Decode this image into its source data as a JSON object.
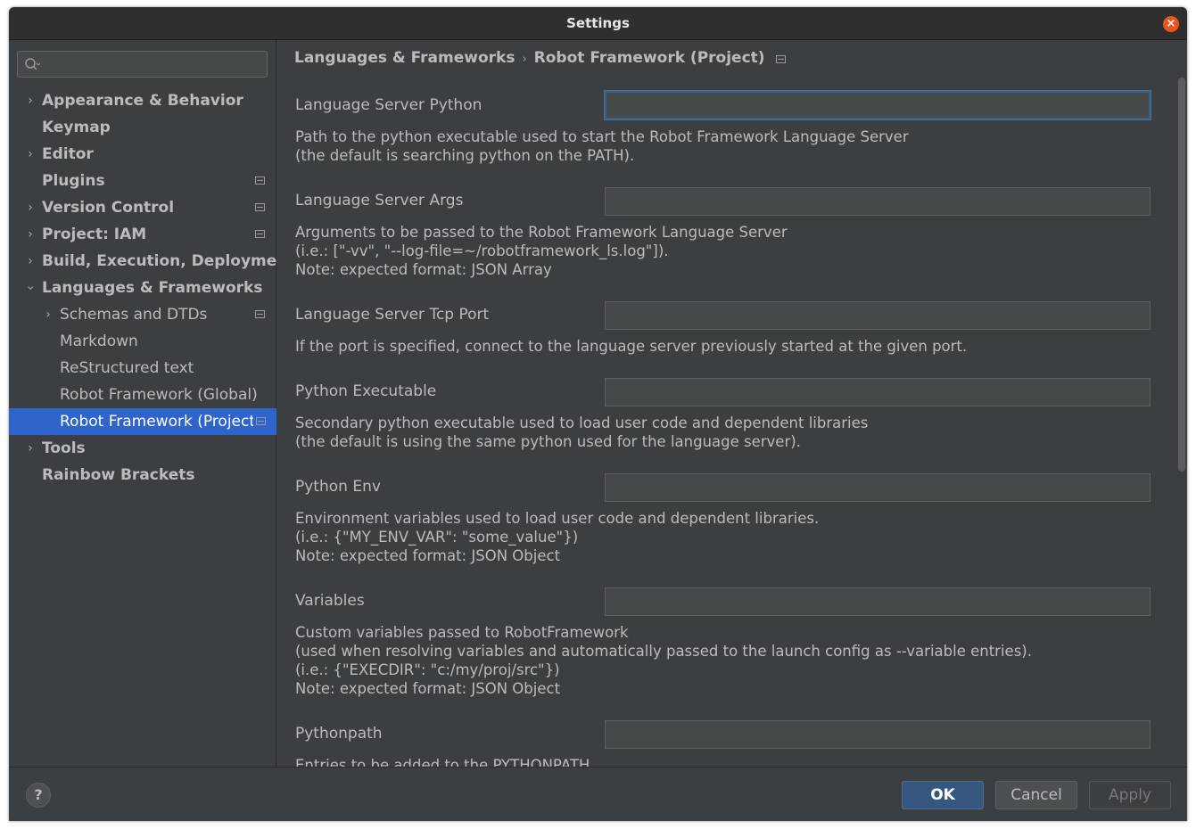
{
  "window": {
    "title": "Settings"
  },
  "sidebar": {
    "search_placeholder": "",
    "items": [
      {
        "label": "Appearance & Behavior"
      },
      {
        "label": "Keymap"
      },
      {
        "label": "Editor"
      },
      {
        "label": "Plugins"
      },
      {
        "label": "Version Control"
      },
      {
        "label": "Project: IAM"
      },
      {
        "label": "Build, Execution, Deployment"
      },
      {
        "label": "Languages & Frameworks"
      },
      {
        "label": "Schemas and DTDs"
      },
      {
        "label": "Markdown"
      },
      {
        "label": "ReStructured text"
      },
      {
        "label": "Robot Framework (Global)"
      },
      {
        "label": "Robot Framework (Project)"
      },
      {
        "label": "Tools"
      },
      {
        "label": "Rainbow Brackets"
      }
    ]
  },
  "breadcrumb": {
    "parent": "Languages & Frameworks",
    "separator": "›",
    "current": "Robot Framework (Project)"
  },
  "fields": [
    {
      "label": "Language Server Python",
      "value": "",
      "desc": [
        "Path to the python executable used to start the Robot Framework Language Server",
        "(the default is searching python on the PATH)."
      ]
    },
    {
      "label": "Language Server Args",
      "value": "",
      "desc": [
        "Arguments to be passed to the Robot Framework Language Server",
        "(i.e.: [\"-vv\", \"--log-file=~/robotframework_ls.log\"]).",
        "Note: expected format: JSON Array"
      ]
    },
    {
      "label": "Language Server Tcp Port",
      "value": "",
      "desc": [
        "If the port is specified, connect to the language server previously started at the given port."
      ]
    },
    {
      "label": "Python Executable",
      "value": "",
      "desc": [
        "Secondary python executable used to load user code and dependent libraries",
        "(the default is using the same python used for the language server)."
      ]
    },
    {
      "label": "Python Env",
      "value": "",
      "desc": [
        "Environment variables used to load user code and dependent libraries.",
        "(i.e.: {\"MY_ENV_VAR\": \"some_value\"})",
        "Note: expected format: JSON Object"
      ]
    },
    {
      "label": "Variables",
      "value": "",
      "desc": [
        "Custom variables passed to RobotFramework",
        "(used when resolving variables and automatically passed to the launch config as --variable entries).",
        "(i.e.: {\"EXECDIR\": \"c:/my/proj/src\"})",
        "Note: expected format: JSON Object"
      ]
    },
    {
      "label": "Pythonpath",
      "value": "",
      "desc": [
        "Entries to be added to the PYTHONPATH"
      ]
    }
  ],
  "footer": {
    "help": "?",
    "ok": "OK",
    "cancel": "Cancel",
    "apply": "Apply"
  },
  "colors": {
    "accent": "#2f65ca",
    "ok_button": "#365880",
    "close_button": "#e95420"
  }
}
